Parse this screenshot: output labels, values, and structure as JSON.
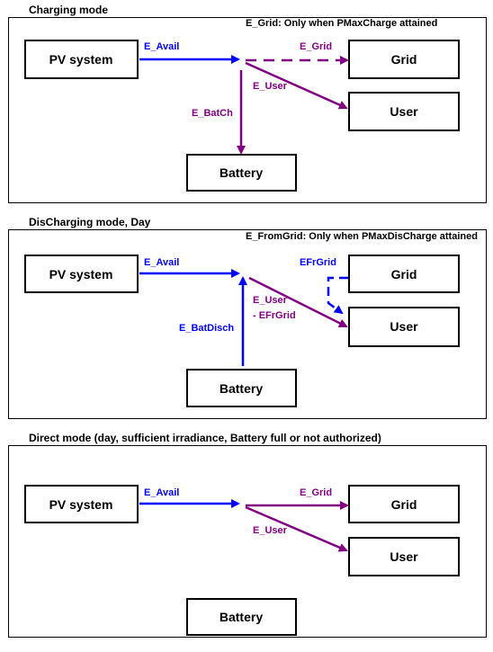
{
  "colors": {
    "blue": "#0000ff",
    "purple": "#800080"
  },
  "panels": [
    {
      "title": "Charging mode",
      "note": "E_Grid: Only when PMaxCharge attained",
      "boxes": {
        "pv": "PV system",
        "grid": "Grid",
        "user": "User",
        "battery": "Battery"
      },
      "labels": {
        "avail": "E_Avail",
        "grid": "E_Grid",
        "user": "E_User",
        "bat": "E_BatCh"
      }
    },
    {
      "title": "DisCharging mode, Day",
      "note": "E_FromGrid: Only when PMaxDisCharge attained",
      "boxes": {
        "pv": "PV system",
        "grid": "Grid",
        "user": "User",
        "battery": "Battery"
      },
      "labels": {
        "avail": "E_Avail",
        "grid": "EFrGrid",
        "user": "E_User",
        "user2": "- EFrGrid",
        "bat": "E_BatDisch"
      }
    },
    {
      "title": "Direct mode  (day, sufficient irradiance, Battery full or not authorized)",
      "boxes": {
        "pv": "PV system",
        "grid": "Grid",
        "user": "User",
        "battery": "Battery"
      },
      "labels": {
        "avail": "E_Avail",
        "grid": "E_Grid",
        "user": "E_User"
      }
    }
  ]
}
